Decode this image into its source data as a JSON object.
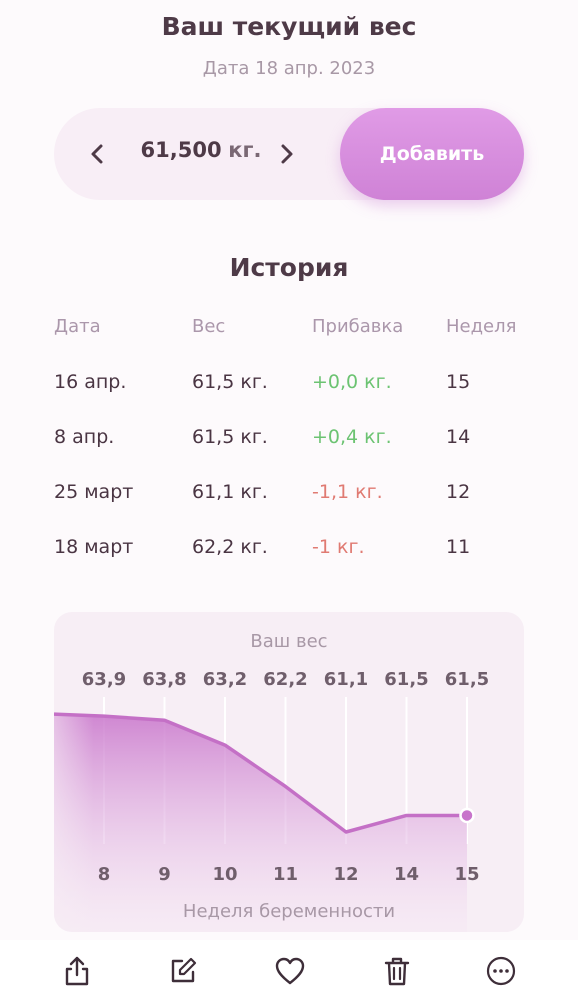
{
  "header": {
    "title": "Ваш текущий вес",
    "date": "Дата 18 апр. 2023"
  },
  "weight_picker": {
    "value": "61,500",
    "unit": "кг.",
    "add_label": "Добавить",
    "prev_icon": "chevron-left-icon",
    "next_icon": "chevron-right-icon"
  },
  "history": {
    "title": "История",
    "columns": [
      "Дата",
      "Вес",
      "Прибавка",
      "Неделя"
    ],
    "rows": [
      {
        "date": "16 апр.",
        "weight": "61,5 кг.",
        "gain": "+0,0 кг.",
        "week": "15",
        "gain_type": "positive"
      },
      {
        "date": "8 апр.",
        "weight": "61,5 кг.",
        "gain": "+0,4 кг.",
        "week": "14",
        "gain_type": "positive"
      },
      {
        "date": "25 март",
        "weight": "61,1 кг.",
        "gain": "-1,1 кг.",
        "week": "12",
        "gain_type": "negative"
      },
      {
        "date": "18 март",
        "weight": "62,2 кг.",
        "gain": "-1 кг.",
        "week": "11",
        "gain_type": "negative"
      }
    ]
  },
  "chart_data": {
    "type": "area",
    "title": "Ваш вес",
    "xlabel": "Неделя беременности",
    "ylabel": "",
    "x": [
      "8",
      "9",
      "10",
      "11",
      "12",
      "14",
      "15"
    ],
    "value_labels": [
      "63,9",
      "63,8",
      "63,2",
      "62,2",
      "61,1",
      "61,5",
      "61,5"
    ],
    "series": [
      {
        "values": [
          63.9,
          63.8,
          63.2,
          62.2,
          61.1,
          61.5,
          61.5
        ]
      }
    ],
    "grid": true,
    "colors": {
      "line": "#c470c6",
      "fill_top": "#c874cb",
      "point": "#c874cb"
    }
  },
  "bottom_bar": {
    "icons": [
      "share-icon",
      "edit-icon",
      "heart-icon",
      "trash-icon",
      "more-icon"
    ]
  },
  "colors": {
    "accent": "#d88ede",
    "positive": "#6cc372",
    "negative": "#e07a72"
  }
}
